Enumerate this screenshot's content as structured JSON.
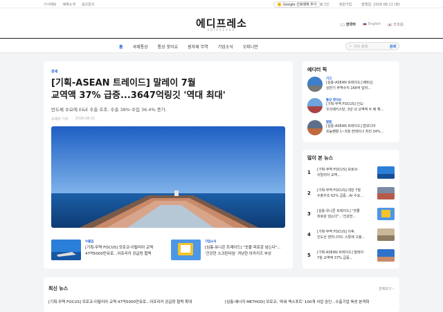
{
  "topbar": {
    "left_links": [
      "기사제보",
      "매체소개",
      "광고문의"
    ],
    "google_button": "Google 선호매체 추가",
    "right_links": [
      "로그인",
      "회원가입",
      "발행일: 2026.08.11 (화)"
    ]
  },
  "header": {
    "logo": "에디프레소",
    "logo_sub": "EDIPRESSO",
    "langs": [
      "한국어",
      "English",
      "日本語"
    ]
  },
  "nav": {
    "items": [
      "홈",
      "국제통상",
      "통상 핫이슈",
      "원자재 무역",
      "기업소식",
      "오피니언"
    ],
    "search_placeholder": "기사 검색",
    "search_button": "검색"
  },
  "main": {
    "category": "관세",
    "headline_line1": "[기획-ASEAN 트레이드] 말레이 7월",
    "headline_line2": "교역액 37% 급증...3647억링깃 '역대 최대'",
    "lede": "반도체 수요에 E&E 수출 호조. 수출 38%·수입 36.4% 증가.",
    "author": "오예라 기자",
    "date": "2026.08.21",
    "sub": [
      {
        "category": "수출입",
        "title_line1": "[기획-무역 FOCUS] 모로코-이탈리아 교역",
        "title_line2": "47억5000만유로...아프리카 공급망 협력"
      },
      {
        "category": "기업소식",
        "title_line1": "[심층-유니콘 트레이드] \"숫줄 피로감 넘는다\"...",
        "title_line2": "'건강한 스크린타임' 겨냥한 아카키즈 부상"
      }
    ]
  },
  "editor_pick": {
    "heading": "에디터 픽",
    "items": [
      {
        "category": "기고",
        "line1": "[심층-ASEAN 트레이드] 베트남,",
        "line2": "상반기 무역수지 166억 달러..."
      },
      {
        "category": "통상 핫이슈",
        "line1": "[기획-무역 FOCUS] 인도-",
        "line2": "우즈베키스탄, 3년 내 교역액 두 배 확..."
      },
      {
        "category": "칼럼",
        "line1": "[심층-ASEAN 트레이드] 캄보디아",
        "line2": "프놈펜항 1~5월 컨테이너 처리 34%..."
      }
    ]
  },
  "popular": {
    "heading": "많이 본 뉴스",
    "items": [
      {
        "num": "1",
        "line1": "[기획-무역 FOCUS] 모로코-",
        "line2": "이탈리아 교역..."
      },
      {
        "num": "2",
        "line1": "[기획-무역 FOCUS] 대만 7월",
        "line2": "수출우조 62% 급증...AI 수요..."
      },
      {
        "num": "3",
        "line1": "[심층-유니콘 트레이드] \"숫줄",
        "line2": "피로감 넘는다\"...'건강한..."
      },
      {
        "num": "4",
        "line1": "[기획-무역 FOCUS] 이후,",
        "line2": "인도산 엔지니어드 스톤에 고율..."
      },
      {
        "num": "5",
        "line1": "[기획-ASEAN 트레이드] 말레이",
        "line2": "7월 교역액 37% 급증..."
      }
    ]
  },
  "latest": {
    "heading": "최신 뉴스",
    "more": "전체보기 ›",
    "items": [
      "[기획-무역 FOCUS] 모로코-이탈리아 교역 47억5000만유로...아프리카 공급망 협력 확대",
      "[심층-에너지 METHOD] 모로코, '파워 엑스포트' 100개 사업 승인...수출기업 육성 본격화"
    ]
  },
  "colors": {
    "accent": "#1a5fd6"
  }
}
